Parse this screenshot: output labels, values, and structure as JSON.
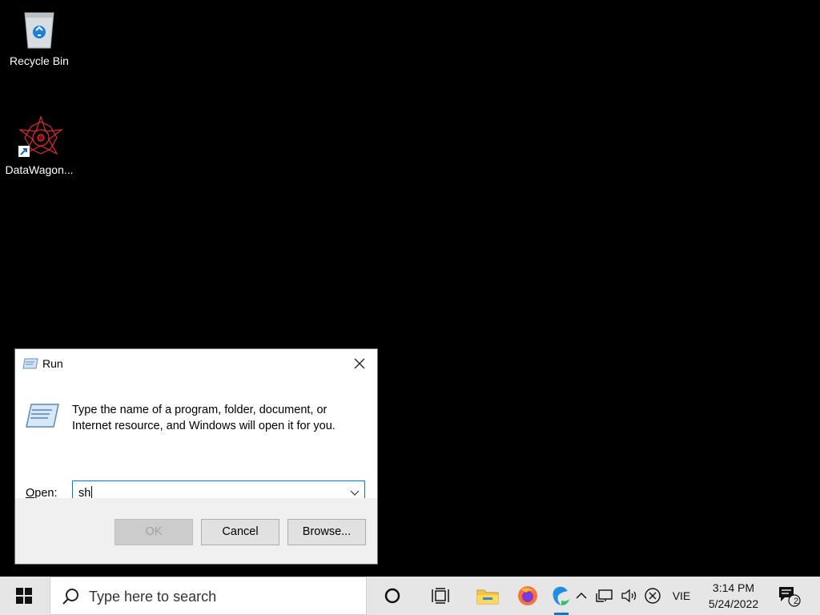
{
  "desktop": {
    "icons": [
      {
        "label": "Recycle Bin",
        "icon": "recycle-bin-icon"
      },
      {
        "label": "DataWagon...",
        "icon": "datawagon-icon"
      }
    ]
  },
  "run_dialog": {
    "title": "Run",
    "description": "Type the name of a program, folder, document, or Internet resource, and Windows will open it for you.",
    "open_label_accel": "O",
    "open_label_rest": "pen:",
    "open_value": "sh",
    "buttons": {
      "ok": "OK",
      "cancel": "Cancel",
      "browse": "Browse..."
    }
  },
  "taskbar": {
    "search_placeholder": "Type here to search",
    "language": "VIE",
    "time": "3:14 PM",
    "date": "5/24/2022",
    "notification_count": "2",
    "accent_color": "#0078d7"
  }
}
